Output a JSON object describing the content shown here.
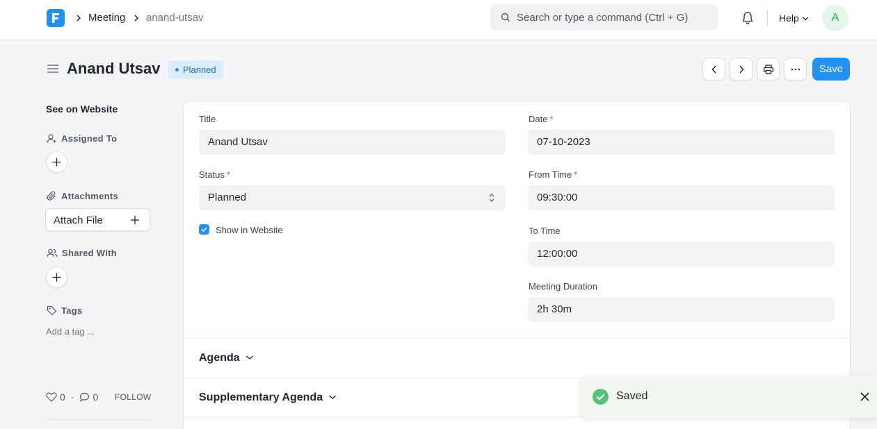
{
  "navbar": {
    "breadcrumbs": [
      "Meeting",
      "anand-utsav"
    ],
    "search_placeholder": "Search or type a command (Ctrl + G)",
    "help_label": "Help",
    "avatar_initial": "A"
  },
  "header": {
    "title": "Anand Utsav",
    "status_badge": "Planned",
    "save_label": "Save"
  },
  "sidebar": {
    "website_link": "See on Website",
    "assigned_to_label": "Assigned To",
    "attachments_label": "Attachments",
    "attach_file_label": "Attach File",
    "shared_with_label": "Shared With",
    "tags_label": "Tags",
    "add_tag_label": "Add a tag ...",
    "likes_count": "0",
    "comments_count": "0",
    "follow_label": "FOLLOW"
  },
  "form": {
    "title_label": "Title",
    "title_value": "Anand Utsav",
    "status_label": "Status",
    "status_value": "Planned",
    "show_in_website_label": "Show in Website",
    "show_in_website_checked": true,
    "date_label": "Date",
    "date_value": "07-10-2023",
    "from_time_label": "From Time",
    "from_time_value": "09:30:00",
    "to_time_label": "To Time",
    "to_time_value": "12:00:00",
    "duration_label": "Meeting Duration",
    "duration_value": "2h 30m",
    "sections": [
      "Agenda",
      "Supplementary Agenda"
    ]
  },
  "toast": {
    "message": "Saved"
  },
  "colors": {
    "accent": "#2490ef",
    "success": "#5ac27c",
    "required": "#e24c4c"
  }
}
